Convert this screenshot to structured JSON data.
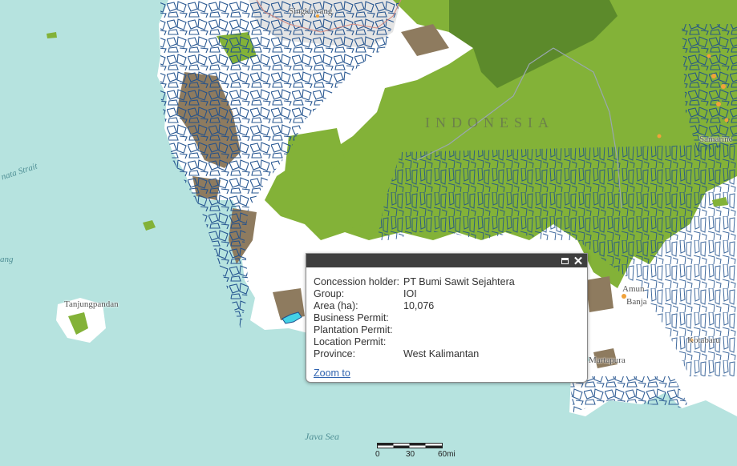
{
  "map": {
    "place_labels": {
      "singkawang": "Singkawang",
      "tanjungpandan": "Tanjungpandan",
      "samarinda_partial": "Samarinc",
      "kotabaru": "Kotabaru",
      "martapura": "Martapura",
      "banjarbaru_partial": "Banja",
      "amuntai_partial": "Amun",
      "karimata_strait_partial": "nata Strait",
      "bangka_partial": "ang",
      "java_sea": "Java Sea",
      "country": "INDONESIA"
    },
    "colors": {
      "water": "#b6e3df",
      "land_cleared": "#ffffff",
      "forest": "#83b238",
      "dark_forest": "#5c8a2b",
      "peat": "#8e7b5f",
      "concession_outline": "#1e4f8c",
      "highlighted_concession": "#44d2e6",
      "mill_dot": "#f0a23a"
    }
  },
  "popup": {
    "attributes": [
      {
        "key": "Concession holder:",
        "value": "PT Bumi Sawit Sejahtera"
      },
      {
        "key": "Group:",
        "value": "IOI"
      },
      {
        "key": "Area (ha):",
        "value": "10,076"
      },
      {
        "key": "Business Permit:",
        "value": ""
      },
      {
        "key": "Plantation Permit:",
        "value": ""
      },
      {
        "key": "Location Permit:",
        "value": ""
      },
      {
        "key": "Province:",
        "value": "West Kalimantan"
      }
    ],
    "zoom_label": "Zoom to",
    "maximize_icon": "maximize-icon",
    "close_icon": "close-icon"
  },
  "scalebar": {
    "ticks": [
      "0",
      "30",
      "60mi"
    ]
  }
}
